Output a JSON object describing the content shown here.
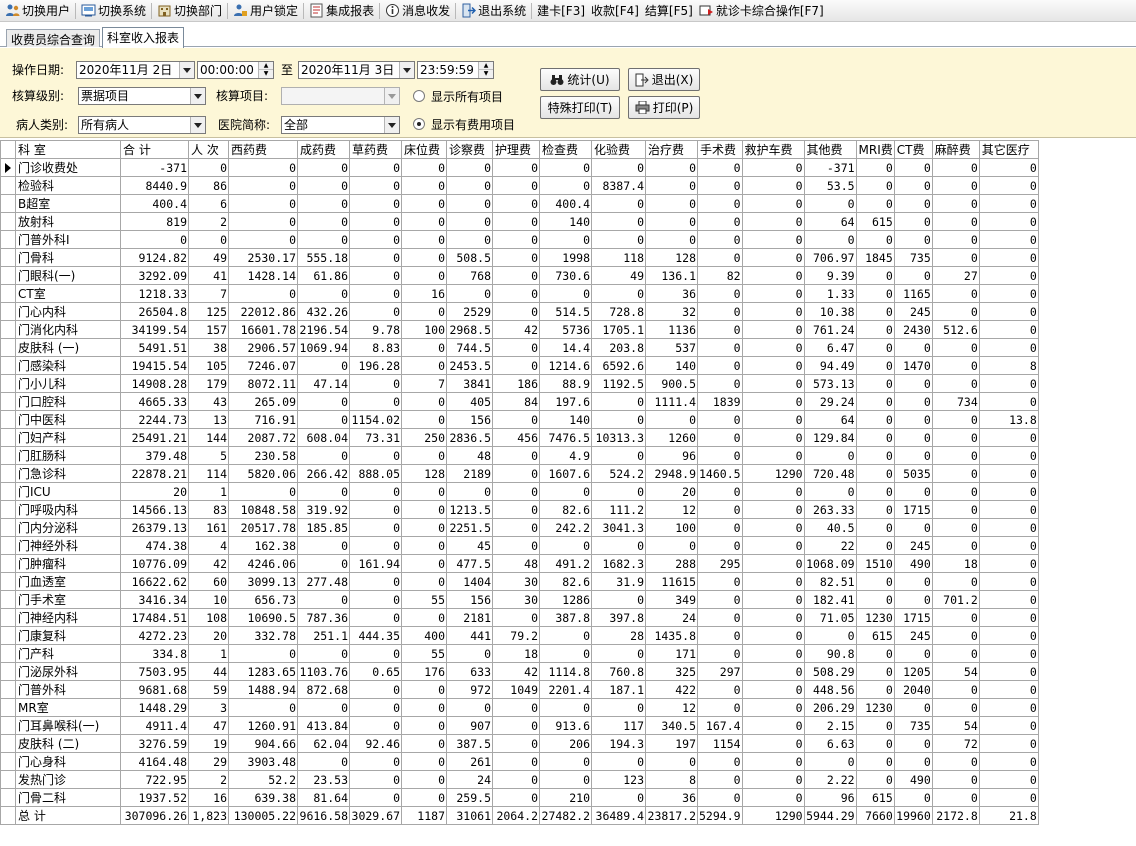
{
  "toolbar": {
    "items": [
      {
        "label": "切换用户",
        "icon": "users-icon"
      },
      {
        "label": "切换系统",
        "icon": "switch-system-icon"
      },
      {
        "label": "切换部门",
        "icon": "department-icon"
      },
      {
        "label": "用户锁定",
        "icon": "user-lock-icon"
      },
      {
        "label": "集成报表",
        "icon": "report-icon"
      },
      {
        "label": "消息收发",
        "icon": "info-icon"
      },
      {
        "label": "退出系统",
        "icon": "exit-icon"
      },
      {
        "label": "建卡[F3]"
      },
      {
        "label": "收款[F4]"
      },
      {
        "label": "结算[F5]"
      },
      {
        "label": "就诊卡综合操作[F7]",
        "icon": "card-operation-icon"
      }
    ]
  },
  "tabs": [
    {
      "label": "收费员综合查询",
      "active": false
    },
    {
      "label": "科室收入报表",
      "active": true
    }
  ],
  "filters": {
    "date_label": "操作日期:",
    "start_date": "2020年11月 2日",
    "start_time": "00:00:00",
    "to_label": "至",
    "end_date": "2020年11月 3日",
    "end_time": "23:59:59",
    "level_label": "核算级别:",
    "level_value": "票据项目",
    "item_label": "核算项目:",
    "item_value": "",
    "patient_label": "病人类别:",
    "patient_value": "所有病人",
    "hospital_label": "医院简称:",
    "hospital_value": "全部",
    "radio_all": "显示所有项目",
    "radio_fee": "显示有费用项目",
    "radio_selected": "fee"
  },
  "buttons": {
    "stat": "统计(U)",
    "exit": "退出(X)",
    "special_print": "特殊打印(T)",
    "print": "打印(P)"
  },
  "table": {
    "headers": [
      "科  室",
      "合  计",
      "人 次",
      "西药费",
      "成药费",
      "草药费",
      "床位费",
      "诊察费",
      "护理费",
      "检查费",
      "化验费",
      "治疗费",
      "手术费",
      "救护车费",
      "其他费",
      "MRI费",
      "CT费",
      "麻醉费",
      "其它医疗"
    ],
    "rows": [
      [
        "门诊收费处",
        "-371",
        "0",
        "0",
        "0",
        "0",
        "0",
        "0",
        "0",
        "0",
        "0",
        "0",
        "0",
        "0",
        "-371",
        "0",
        "0",
        "0",
        "0"
      ],
      [
        "检验科",
        "8440.9",
        "86",
        "0",
        "0",
        "0",
        "0",
        "0",
        "0",
        "0",
        "8387.4",
        "0",
        "0",
        "0",
        "53.5",
        "0",
        "0",
        "0",
        "0"
      ],
      [
        "B超室",
        "400.4",
        "6",
        "0",
        "0",
        "0",
        "0",
        "0",
        "0",
        "400.4",
        "0",
        "0",
        "0",
        "0",
        "0",
        "0",
        "0",
        "0",
        "0"
      ],
      [
        "放射科",
        "819",
        "2",
        "0",
        "0",
        "0",
        "0",
        "0",
        "0",
        "140",
        "0",
        "0",
        "0",
        "0",
        "64",
        "615",
        "0",
        "0",
        "0"
      ],
      [
        "门普外科Ⅰ",
        "0",
        "0",
        "0",
        "0",
        "0",
        "0",
        "0",
        "0",
        "0",
        "0",
        "0",
        "0",
        "0",
        "0",
        "0",
        "0",
        "0",
        "0"
      ],
      [
        "门骨科",
        "9124.82",
        "49",
        "2530.17",
        "555.18",
        "0",
        "0",
        "508.5",
        "0",
        "1998",
        "118",
        "128",
        "0",
        "0",
        "706.97",
        "1845",
        "735",
        "0",
        "0"
      ],
      [
        "门眼科(一)",
        "3292.09",
        "41",
        "1428.14",
        "61.86",
        "0",
        "0",
        "768",
        "0",
        "730.6",
        "49",
        "136.1",
        "82",
        "0",
        "9.39",
        "0",
        "0",
        "27",
        "0"
      ],
      [
        "CT室",
        "1218.33",
        "7",
        "0",
        "0",
        "0",
        "16",
        "0",
        "0",
        "0",
        "0",
        "36",
        "0",
        "0",
        "1.33",
        "0",
        "1165",
        "0",
        "0"
      ],
      [
        "门心内科",
        "26504.8",
        "125",
        "22012.86",
        "432.26",
        "0",
        "0",
        "2529",
        "0",
        "514.5",
        "728.8",
        "32",
        "0",
        "0",
        "10.38",
        "0",
        "245",
        "0",
        "0"
      ],
      [
        "门消化内科",
        "34199.54",
        "157",
        "16601.78",
        "2196.54",
        "9.78",
        "100",
        "2968.5",
        "42",
        "5736",
        "1705.1",
        "1136",
        "0",
        "0",
        "761.24",
        "0",
        "2430",
        "512.6",
        "0"
      ],
      [
        "皮肤科 (一)",
        "5491.51",
        "38",
        "2906.57",
        "1069.94",
        "8.83",
        "0",
        "744.5",
        "0",
        "14.4",
        "203.8",
        "537",
        "0",
        "0",
        "6.47",
        "0",
        "0",
        "0",
        "0"
      ],
      [
        "门感染科",
        "19415.54",
        "105",
        "7246.07",
        "0",
        "196.28",
        "0",
        "2453.5",
        "0",
        "1214.6",
        "6592.6",
        "140",
        "0",
        "0",
        "94.49",
        "0",
        "1470",
        "0",
        "8"
      ],
      [
        "门小儿科",
        "14908.28",
        "179",
        "8072.11",
        "47.14",
        "0",
        "7",
        "3841",
        "186",
        "88.9",
        "1192.5",
        "900.5",
        "0",
        "0",
        "573.13",
        "0",
        "0",
        "0",
        "0"
      ],
      [
        "门口腔科",
        "4665.33",
        "43",
        "265.09",
        "0",
        "0",
        "0",
        "405",
        "84",
        "197.6",
        "0",
        "1111.4",
        "1839",
        "0",
        "29.24",
        "0",
        "0",
        "734",
        "0"
      ],
      [
        "门中医科",
        "2244.73",
        "13",
        "716.91",
        "0",
        "1154.02",
        "0",
        "156",
        "0",
        "140",
        "0",
        "0",
        "0",
        "0",
        "64",
        "0",
        "0",
        "0",
        "13.8"
      ],
      [
        "门妇产科",
        "25491.21",
        "144",
        "2087.72",
        "608.04",
        "73.31",
        "250",
        "2836.5",
        "456",
        "7476.5",
        "10313.3",
        "1260",
        "0",
        "0",
        "129.84",
        "0",
        "0",
        "0",
        "0"
      ],
      [
        "门肛肠科",
        "379.48",
        "5",
        "230.58",
        "0",
        "0",
        "0",
        "48",
        "0",
        "4.9",
        "0",
        "96",
        "0",
        "0",
        "0",
        "0",
        "0",
        "0",
        "0"
      ],
      [
        "门急诊科",
        "22878.21",
        "114",
        "5820.06",
        "266.42",
        "888.05",
        "128",
        "2189",
        "0",
        "1607.6",
        "524.2",
        "2948.9",
        "1460.5",
        "1290",
        "720.48",
        "0",
        "5035",
        "0",
        "0"
      ],
      [
        "门ICU",
        "20",
        "1",
        "0",
        "0",
        "0",
        "0",
        "0",
        "0",
        "0",
        "0",
        "20",
        "0",
        "0",
        "0",
        "0",
        "0",
        "0",
        "0"
      ],
      [
        "门呼吸内科",
        "14566.13",
        "83",
        "10848.58",
        "319.92",
        "0",
        "0",
        "1213.5",
        "0",
        "82.6",
        "111.2",
        "12",
        "0",
        "0",
        "263.33",
        "0",
        "1715",
        "0",
        "0"
      ],
      [
        "门内分泌科",
        "26379.13",
        "161",
        "20517.78",
        "185.85",
        "0",
        "0",
        "2251.5",
        "0",
        "242.2",
        "3041.3",
        "100",
        "0",
        "0",
        "40.5",
        "0",
        "0",
        "0",
        "0"
      ],
      [
        "门神经外科",
        "474.38",
        "4",
        "162.38",
        "0",
        "0",
        "0",
        "45",
        "0",
        "0",
        "0",
        "0",
        "0",
        "0",
        "22",
        "0",
        "245",
        "0",
        "0"
      ],
      [
        "门肿瘤科",
        "10776.09",
        "42",
        "4246.06",
        "0",
        "161.94",
        "0",
        "477.5",
        "48",
        "491.2",
        "1682.3",
        "288",
        "295",
        "0",
        "1068.09",
        "1510",
        "490",
        "18",
        "0"
      ],
      [
        "门血透室",
        "16622.62",
        "60",
        "3099.13",
        "277.48",
        "0",
        "0",
        "1404",
        "30",
        "82.6",
        "31.9",
        "11615",
        "0",
        "0",
        "82.51",
        "0",
        "0",
        "0",
        "0"
      ],
      [
        "门手术室",
        "3416.34",
        "10",
        "656.73",
        "0",
        "0",
        "55",
        "156",
        "30",
        "1286",
        "0",
        "349",
        "0",
        "0",
        "182.41",
        "0",
        "0",
        "701.2",
        "0"
      ],
      [
        "门神经内科",
        "17484.51",
        "108",
        "10690.5",
        "787.36",
        "0",
        "0",
        "2181",
        "0",
        "387.8",
        "397.8",
        "24",
        "0",
        "0",
        "71.05",
        "1230",
        "1715",
        "0",
        "0"
      ],
      [
        "门康复科",
        "4272.23",
        "20",
        "332.78",
        "251.1",
        "444.35",
        "400",
        "441",
        "79.2",
        "0",
        "28",
        "1435.8",
        "0",
        "0",
        "0",
        "615",
        "245",
        "0",
        "0"
      ],
      [
        "门产科",
        "334.8",
        "1",
        "0",
        "0",
        "0",
        "55",
        "0",
        "18",
        "0",
        "0",
        "171",
        "0",
        "0",
        "90.8",
        "0",
        "0",
        "0",
        "0"
      ],
      [
        "门泌尿外科",
        "7503.95",
        "44",
        "1283.65",
        "1103.76",
        "0.65",
        "176",
        "633",
        "42",
        "1114.8",
        "760.8",
        "325",
        "297",
        "0",
        "508.29",
        "0",
        "1205",
        "54",
        "0"
      ],
      [
        "门普外科",
        "9681.68",
        "59",
        "1488.94",
        "872.68",
        "0",
        "0",
        "972",
        "1049",
        "2201.4",
        "187.1",
        "422",
        "0",
        "0",
        "448.56",
        "0",
        "2040",
        "0",
        "0"
      ],
      [
        "MR室",
        "1448.29",
        "3",
        "0",
        "0",
        "0",
        "0",
        "0",
        "0",
        "0",
        "0",
        "12",
        "0",
        "0",
        "206.29",
        "1230",
        "0",
        "0",
        "0"
      ],
      [
        "门耳鼻喉科(一)",
        "4911.4",
        "47",
        "1260.91",
        "413.84",
        "0",
        "0",
        "907",
        "0",
        "913.6",
        "117",
        "340.5",
        "167.4",
        "0",
        "2.15",
        "0",
        "735",
        "54",
        "0"
      ],
      [
        "皮肤科 (二)",
        "3276.59",
        "19",
        "904.66",
        "62.04",
        "92.46",
        "0",
        "387.5",
        "0",
        "206",
        "194.3",
        "197",
        "1154",
        "0",
        "6.63",
        "0",
        "0",
        "72",
        "0"
      ],
      [
        "门心身科",
        "4164.48",
        "29",
        "3903.48",
        "0",
        "0",
        "0",
        "261",
        "0",
        "0",
        "0",
        "0",
        "0",
        "0",
        "0",
        "0",
        "0",
        "0",
        "0"
      ],
      [
        "发热门诊",
        "722.95",
        "2",
        "52.2",
        "23.53",
        "0",
        "0",
        "24",
        "0",
        "0",
        "123",
        "8",
        "0",
        "0",
        "2.22",
        "0",
        "490",
        "0",
        "0"
      ],
      [
        "门骨二科",
        "1937.52",
        "16",
        "639.38",
        "81.64",
        "0",
        "0",
        "259.5",
        "0",
        "210",
        "0",
        "36",
        "0",
        "0",
        "96",
        "615",
        "0",
        "0",
        "0"
      ],
      [
        "总  计",
        "307096.26",
        "1,823",
        "130005.22",
        "9616.58",
        "3029.67",
        "1187",
        "31061",
        "2064.2",
        "27482.2",
        "36489.4",
        "23817.2",
        "5294.9",
        "1290",
        "5944.29",
        "7660",
        "19960",
        "2172.8",
        "21.8"
      ]
    ]
  }
}
